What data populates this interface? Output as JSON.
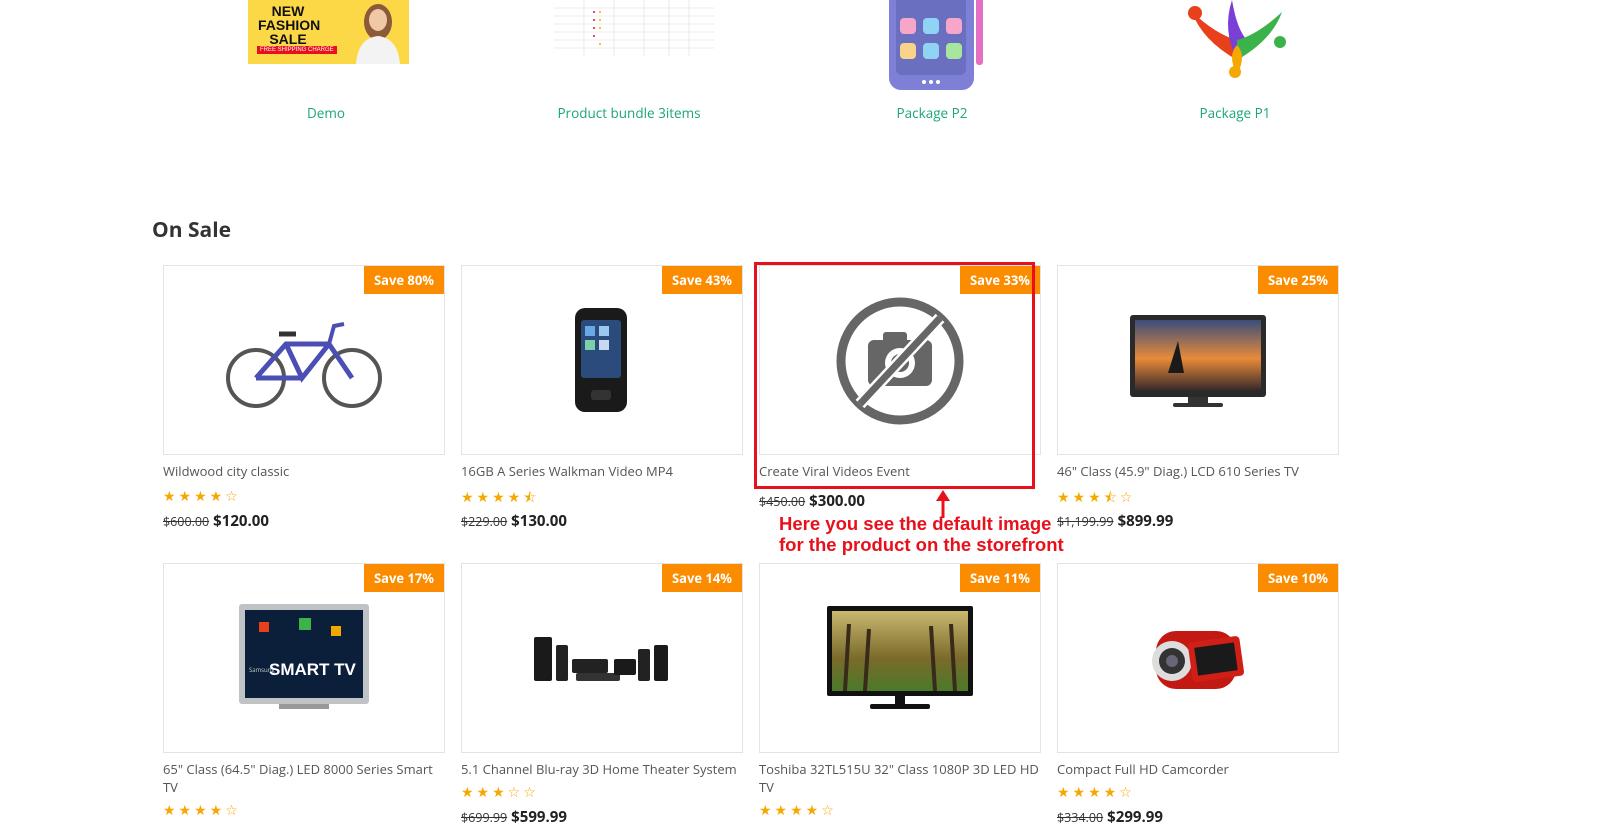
{
  "categories": [
    {
      "label": "Demo",
      "image": "fashion-sale-banner",
      "banner_text": "NEW FASHION SALE",
      "banner_sub": "FREE SHIPPING CHARGE"
    },
    {
      "label": "Product bundle 3items",
      "image": "table-screenshot"
    },
    {
      "label": "Package P2",
      "image": "tablet-device"
    },
    {
      "label": "Package P1",
      "image": "people-logo"
    }
  ],
  "section": {
    "title": "On Sale"
  },
  "products": [
    {
      "badge": "Save 80%",
      "name": "Wildwood city classic",
      "stars": "★★★★☆",
      "old_price": "$600.00",
      "price": "$120.00",
      "image": "bicycle"
    },
    {
      "badge": "Save 43%",
      "name": "16GB A Series Walkman Video MP4",
      "stars": "★★★★⯪",
      "old_price": "$229.00",
      "price": "$130.00",
      "image": "walkman"
    },
    {
      "badge": "Save 33%",
      "name": "Create Viral Videos Event",
      "stars": "",
      "old_price": "$450.00",
      "price": "$300.00",
      "image": "no-image-placeholder"
    },
    {
      "badge": "Save 25%",
      "name": "46\" Class (45.9\" Diag.) LCD 610 Series TV",
      "stars": "★★★⯪☆",
      "old_price": "$1,199.99",
      "price": "$899.99",
      "image": "lcd-tv-sunset"
    },
    {
      "badge": "Save 17%",
      "name": "65\" Class (64.5\" Diag.) LED 8000 Series Smart TV",
      "stars": "★★★★☆",
      "old_price": "",
      "price": "",
      "image": "smart-tv",
      "tv_text": "SMART TV",
      "tv_brand": "Samsung"
    },
    {
      "badge": "Save 14%",
      "name": "5.1 Channel Blu-ray 3D Home Theater System",
      "stars": "★★★☆☆",
      "old_price": "$699.99",
      "price": "$599.99",
      "image": "home-theater"
    },
    {
      "badge": "Save 11%",
      "name": "Toshiba 32TL515U 32\" Class 1080P 3D LED HD TV",
      "stars": "★★★★☆",
      "old_price": "",
      "price": "",
      "image": "tv-park"
    },
    {
      "badge": "Save 10%",
      "name": "Compact Full HD Camcorder",
      "stars": "★★★★☆",
      "old_price": "$334.00",
      "price": "$299.99",
      "image": "camcorder"
    }
  ],
  "annotation": {
    "text": "Here you see the default image\nfor the product on the storefront",
    "color": "#e8101b"
  },
  "colors": {
    "accent_link": "#1aa678",
    "badge": "#fb8c00",
    "stars": "#f5a800"
  }
}
